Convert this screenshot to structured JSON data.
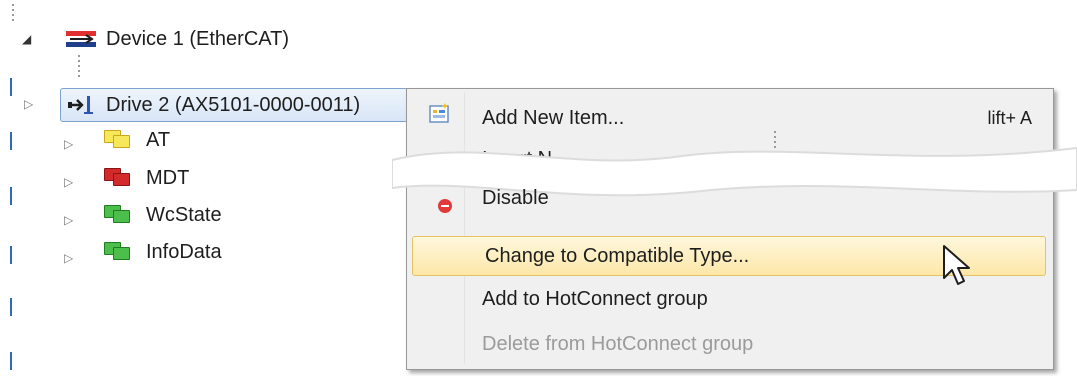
{
  "tree": {
    "device_label": "Device 1 (EtherCAT)",
    "drive_label": "Drive 2 (AX5101-0000-0011)",
    "children": [
      {
        "label": "AT",
        "icon": "yellow-box-icon",
        "color": "#f7e85a"
      },
      {
        "label": "MDT",
        "icon": "red-box-icon",
        "color": "#d32b2b"
      },
      {
        "label": "WcState",
        "icon": "green-box-icon",
        "color": "#4cbe4c"
      },
      {
        "label": "InfoData",
        "icon": "green-box-icon",
        "color": "#4cbe4c"
      }
    ]
  },
  "context_menu": {
    "items": [
      {
        "label": "Add New Item...",
        "shortcut": "lift+ A",
        "icon": "add-new-item-icon"
      },
      {
        "label": "Insert N",
        "icon": ""
      },
      {
        "label": "Disable",
        "icon": "disable-icon"
      },
      {
        "label": "Change to Compatible Type...",
        "state": "highlighted"
      },
      {
        "label": "Add to HotConnect group"
      },
      {
        "label": "Delete from HotConnect group",
        "state": "disabled"
      }
    ]
  },
  "colors": {
    "tree_line": "#2f6bb5",
    "selection_border": "#7da2ce",
    "highlight_fill": "#fde7a8",
    "menu_background": "#f0f0f0",
    "disabled_text": "#9b9b9b"
  }
}
